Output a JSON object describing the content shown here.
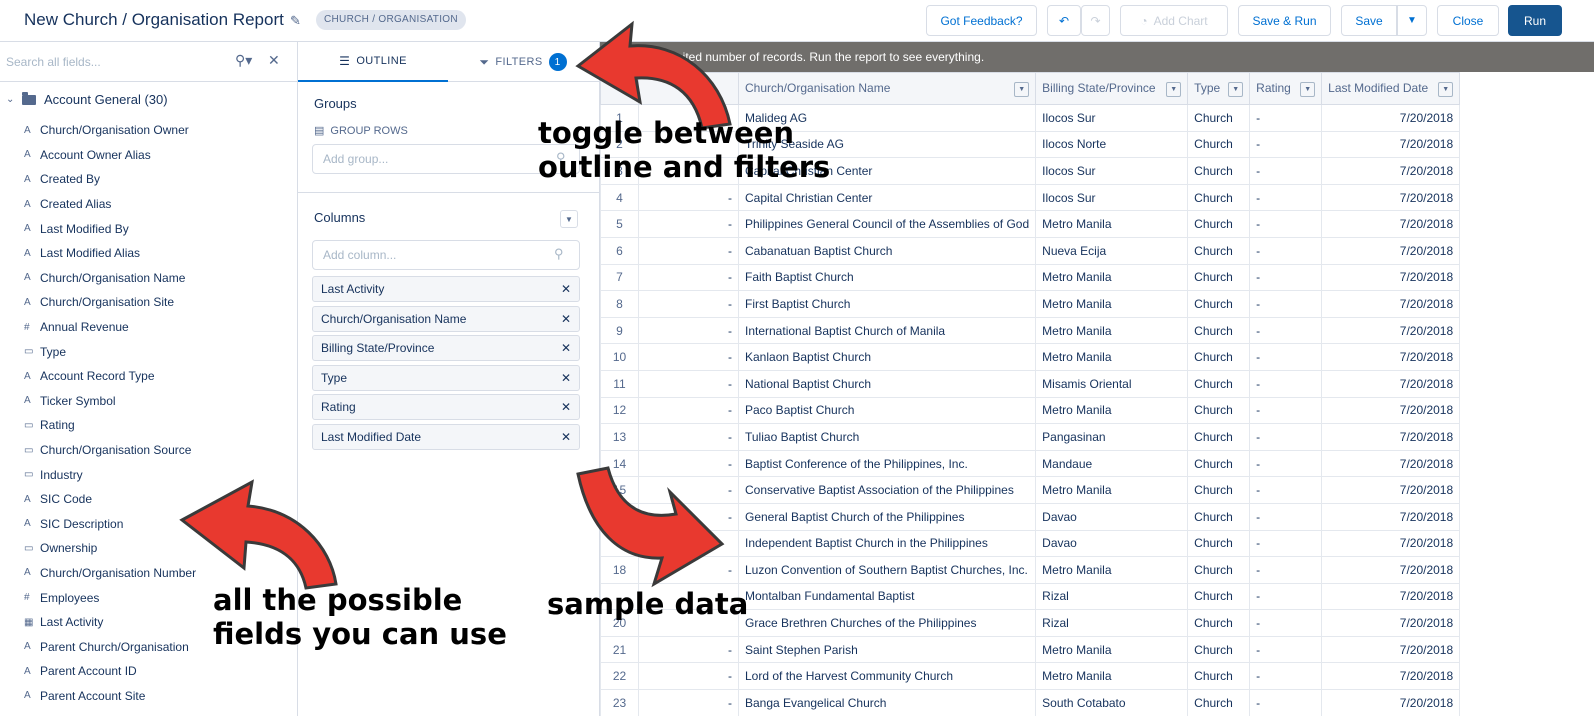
{
  "header": {
    "title": "New Church / Organisation Report",
    "pill": "CHURCH / ORGANISATION",
    "buttons": {
      "feedback": "Got Feedback?",
      "add_chart": "Add Chart",
      "save_run": "Save & Run",
      "save": "Save",
      "close": "Close",
      "run": "Run"
    }
  },
  "sidebar": {
    "search_placeholder": "Search all fields...",
    "group_label": "Account General (30)",
    "fields": [
      {
        "label": "Church/Organisation Owner",
        "icon": "A"
      },
      {
        "label": "Account Owner Alias",
        "icon": "A"
      },
      {
        "label": "Created By",
        "icon": "A"
      },
      {
        "label": "Created Alias",
        "icon": "A"
      },
      {
        "label": "Last Modified By",
        "icon": "A"
      },
      {
        "label": "Last Modified Alias",
        "icon": "A"
      },
      {
        "label": "Church/Organisation Name",
        "icon": "A"
      },
      {
        "label": "Church/Organisation Site",
        "icon": "A"
      },
      {
        "label": "Annual Revenue",
        "icon": "#"
      },
      {
        "label": "Type",
        "icon": "▭"
      },
      {
        "label": "Account Record Type",
        "icon": "A"
      },
      {
        "label": "Ticker Symbol",
        "icon": "A"
      },
      {
        "label": "Rating",
        "icon": "▭"
      },
      {
        "label": "Church/Organisation Source",
        "icon": "▭"
      },
      {
        "label": "Industry",
        "icon": "▭"
      },
      {
        "label": "SIC Code",
        "icon": "A"
      },
      {
        "label": "SIC Description",
        "icon": "A"
      },
      {
        "label": "Ownership",
        "icon": "▭"
      },
      {
        "label": "Church/Organisation Number",
        "icon": "A"
      },
      {
        "label": "Employees",
        "icon": "#"
      },
      {
        "label": "Last Activity",
        "icon": "▦"
      },
      {
        "label": "Parent Church/Organisation",
        "icon": "A"
      },
      {
        "label": "Parent Account ID",
        "icon": "A"
      },
      {
        "label": "Parent Account Site",
        "icon": "A"
      }
    ]
  },
  "panel": {
    "tab_outline": "OUTLINE",
    "tab_filters": "FILTERS",
    "filters_count": "1",
    "groups_title": "Groups",
    "group_rows_label": "GROUP ROWS",
    "add_group_placeholder": "Add group...",
    "columns_title": "Columns",
    "add_column_placeholder": "Add column...",
    "columns": [
      "Last Activity",
      "Church/Organisation Name",
      "Billing State/Province",
      "Type",
      "Rating",
      "Last Modified Date"
    ]
  },
  "table": {
    "notice": "imited number of records. Run the report to see everything.",
    "headers": [
      "Church/Organisation Name",
      "Billing State/Province",
      "Type",
      "Rating",
      "Last Modified Date"
    ],
    "rows": [
      {
        "n": "1",
        "a": "",
        "name": "Malideg AG",
        "state": "Ilocos Sur",
        "type": "Church",
        "rating": "-",
        "date": "7/20/2018"
      },
      {
        "n": "2",
        "a": "",
        "name": "Trinity Seaside AG",
        "state": "Ilocos Norte",
        "type": "Church",
        "rating": "-",
        "date": "7/20/2018"
      },
      {
        "n": "3",
        "a": "",
        "name": "Capital Christian Center",
        "state": "Ilocos Sur",
        "type": "Church",
        "rating": "-",
        "date": "7/20/2018"
      },
      {
        "n": "4",
        "a": "-",
        "name": "Capital Christian Center",
        "state": "Ilocos Sur",
        "type": "Church",
        "rating": "-",
        "date": "7/20/2018"
      },
      {
        "n": "5",
        "a": "-",
        "name": "Philippines General Council of the Assemblies of God",
        "state": "Metro Manila",
        "type": "Church",
        "rating": "-",
        "date": "7/20/2018"
      },
      {
        "n": "6",
        "a": "-",
        "name": "Cabanatuan Baptist Church",
        "state": "Nueva Ecija",
        "type": "Church",
        "rating": "-",
        "date": "7/20/2018"
      },
      {
        "n": "7",
        "a": "-",
        "name": "Faith Baptist Church",
        "state": "Metro Manila",
        "type": "Church",
        "rating": "-",
        "date": "7/20/2018"
      },
      {
        "n": "8",
        "a": "-",
        "name": "First Baptist Church",
        "state": "Metro Manila",
        "type": "Church",
        "rating": "-",
        "date": "7/20/2018"
      },
      {
        "n": "9",
        "a": "-",
        "name": "International Baptist Church of Manila",
        "state": "Metro Manila",
        "type": "Church",
        "rating": "-",
        "date": "7/20/2018"
      },
      {
        "n": "10",
        "a": "-",
        "name": "Kanlaon Baptist Church",
        "state": "Metro Manila",
        "type": "Church",
        "rating": "-",
        "date": "7/20/2018"
      },
      {
        "n": "11",
        "a": "-",
        "name": "National Baptist Church",
        "state": "Misamis Oriental",
        "type": "Church",
        "rating": "-",
        "date": "7/20/2018"
      },
      {
        "n": "12",
        "a": "-",
        "name": "Paco Baptist Church",
        "state": "Metro Manila",
        "type": "Church",
        "rating": "-",
        "date": "7/20/2018"
      },
      {
        "n": "13",
        "a": "-",
        "name": "Tuliao Baptist Church",
        "state": "Pangasinan",
        "type": "Church",
        "rating": "-",
        "date": "7/20/2018"
      },
      {
        "n": "14",
        "a": "-",
        "name": "Baptist Conference of the Philippines, Inc.",
        "state": "Mandaue",
        "type": "Church",
        "rating": "-",
        "date": "7/20/2018"
      },
      {
        "n": "15",
        "a": "-",
        "name": "Conservative Baptist Association of the Philippines",
        "state": "Metro Manila",
        "type": "Church",
        "rating": "-",
        "date": "7/20/2018"
      },
      {
        "n": "",
        "a": "-",
        "name": "General Baptist Church of the Philippines",
        "state": "Davao",
        "type": "Church",
        "rating": "-",
        "date": "7/20/2018"
      },
      {
        "n": "",
        "a": "",
        "name": "Independent Baptist Church in the Philippines",
        "state": "Davao",
        "type": "Church",
        "rating": "-",
        "date": "7/20/2018"
      },
      {
        "n": "18",
        "a": "-",
        "name": "Luzon Convention of Southern Baptist Churches, Inc.",
        "state": "Metro Manila",
        "type": "Church",
        "rating": "-",
        "date": "7/20/2018"
      },
      {
        "n": "",
        "a": "",
        "name": "Montalban Fundamental Baptist",
        "state": "Rizal",
        "type": "Church",
        "rating": "-",
        "date": "7/20/2018"
      },
      {
        "n": "20",
        "a": "",
        "name": "Grace Brethren Churches of the Philippines",
        "state": "Rizal",
        "type": "Church",
        "rating": "-",
        "date": "7/20/2018"
      },
      {
        "n": "21",
        "a": "-",
        "name": "Saint Stephen Parish",
        "state": "Metro Manila",
        "type": "Church",
        "rating": "-",
        "date": "7/20/2018"
      },
      {
        "n": "22",
        "a": "-",
        "name": "Lord of the Harvest Community Church",
        "state": "Metro Manila",
        "type": "Church",
        "rating": "-",
        "date": "7/20/2018"
      },
      {
        "n": "23",
        "a": "-",
        "name": "Banga Evangelical Church",
        "state": "South Cotabato",
        "type": "Church",
        "rating": "-",
        "date": "7/20/2018"
      }
    ]
  },
  "annotations": {
    "toggle_line1": "toggle between",
    "toggle_line2": "outline and filters",
    "fields_line1": "all the possible",
    "fields_line2": "fields you can use",
    "sample": "sample data"
  },
  "colors": {
    "brand": "#16558f",
    "link": "#0070d2",
    "arrow_red": "#e8392f",
    "notice_bg": "#706e6b"
  }
}
